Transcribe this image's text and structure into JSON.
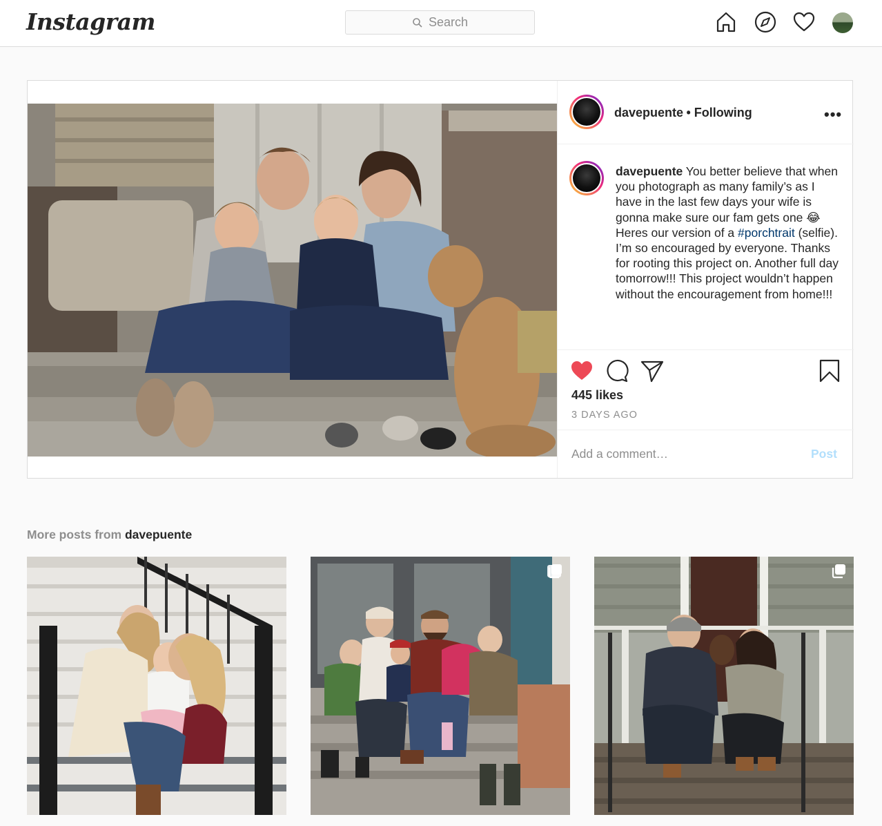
{
  "nav": {
    "logo": "Instagram",
    "search_placeholder": "Search",
    "icons": [
      "home-icon",
      "explore-icon",
      "activity-heart-icon",
      "profile-avatar"
    ]
  },
  "post": {
    "username": "davepuente",
    "following_text": "• Following",
    "more_icon": "•••",
    "caption": {
      "username": "davepuente",
      "text_before": "You better believe that when you photograph as many family’s as I have in the last few days your wife is gonna make sure our fam gets one 😂 Heres our version of a",
      "hashtag": "#porchtrait",
      "text_after": "(selfie). I’m so encouraged by everyone. Thanks for rooting this project on. Another full day tomorrow!!! This project wouldn’t happen without the encouragement from home!!!"
    },
    "likes": "445 likes",
    "time_ago": "3 DAYS AGO",
    "comment_placeholder": "Add a comment…",
    "post_button": "Post",
    "liked": true,
    "like_color": "#ed4956"
  },
  "more_posts": {
    "prefix": "More posts from",
    "username": "davepuente"
  }
}
